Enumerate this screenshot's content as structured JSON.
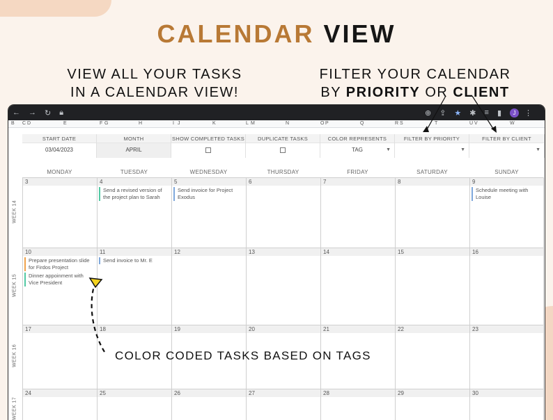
{
  "hero": {
    "title_accent": "CALENDAR",
    "title_dark": "VIEW"
  },
  "captions": {
    "left_line1": "VIEW ALL YOUR TASKS",
    "left_line2": "IN A CALENDAR VIEW!",
    "right_line1": "FILTER YOUR CALENDAR",
    "right_by": "BY",
    "right_priority": "PRIORITY",
    "right_or": "OR",
    "right_client": "CLIENT"
  },
  "annotation": "COLOR CODED TASKS BASED ON TAGS",
  "browser": {
    "avatar": "J",
    "icons": [
      "back-icon",
      "forward-icon",
      "reload-icon",
      "lock-icon",
      "zoom-icon",
      "share-icon",
      "star-icon",
      "extensions-icon",
      "reading-list-icon",
      "sidebar-icon",
      "menu-icon"
    ]
  },
  "column_letters": [
    "B",
    "C",
    "D",
    "E",
    "F",
    "G",
    "H",
    "I",
    "J",
    "K",
    "L",
    "M",
    "N",
    "O",
    "P",
    "Q",
    "R",
    "S",
    "T",
    "U",
    "V",
    "W"
  ],
  "controls": {
    "start_date": {
      "label": "START DATE",
      "value": "03/04/2023"
    },
    "period": {
      "label": "MONTH",
      "value": "APRIL"
    },
    "show_completed": {
      "label": "SHOW COMPLETED TASKS"
    },
    "duplicate": {
      "label": "DUPLICATE TASKS"
    },
    "color_represents": {
      "label": "COLOR REPRESENTS",
      "value": "TAG"
    },
    "filter_priority": {
      "label": "FILTER BY PRIORITY",
      "value": ""
    },
    "filter_client": {
      "label": "FILTER BY CLIENT",
      "value": ""
    }
  },
  "day_names": [
    "MONDAY",
    "TUESDAY",
    "WEDNESDAY",
    "THURSDAY",
    "FRIDAY",
    "SATURDAY",
    "SUNDAY"
  ],
  "weeks": [
    {
      "label": "WEEK 14",
      "days": [
        {
          "num": "3",
          "tasks": []
        },
        {
          "num": "4",
          "tasks": [
            {
              "text": "Send a revised version of the project plan to Sarah",
              "color": "green"
            }
          ]
        },
        {
          "num": "5",
          "tasks": [
            {
              "text": "Send invoice for Project Exodus",
              "color": "blue"
            }
          ]
        },
        {
          "num": "6",
          "tasks": []
        },
        {
          "num": "7",
          "tasks": []
        },
        {
          "num": "8",
          "tasks": []
        },
        {
          "num": "9",
          "tasks": [
            {
              "text": "Schedule meeting with Louise",
              "color": "blue"
            }
          ]
        }
      ]
    },
    {
      "label": "WEEK 15",
      "days": [
        {
          "num": "10",
          "tasks": [
            {
              "text": "Prepare presentation slide for Firdos Project",
              "color": "orange"
            },
            {
              "text": "Dinner appoinment with Vice President",
              "color": "green"
            }
          ]
        },
        {
          "num": "11",
          "tasks": [
            {
              "text": "Send invoice to Mr. E",
              "color": "blue"
            }
          ]
        },
        {
          "num": "12",
          "tasks": []
        },
        {
          "num": "13",
          "tasks": []
        },
        {
          "num": "14",
          "tasks": []
        },
        {
          "num": "15",
          "tasks": []
        },
        {
          "num": "16",
          "tasks": []
        }
      ]
    },
    {
      "label": "WEEK 16",
      "days": [
        {
          "num": "17",
          "tasks": []
        },
        {
          "num": "18",
          "tasks": []
        },
        {
          "num": "19",
          "tasks": []
        },
        {
          "num": "20",
          "tasks": []
        },
        {
          "num": "21",
          "tasks": []
        },
        {
          "num": "22",
          "tasks": []
        },
        {
          "num": "23",
          "tasks": []
        }
      ]
    },
    {
      "label": "WEEK 17",
      "days": [
        {
          "num": "24",
          "tasks": []
        },
        {
          "num": "25",
          "tasks": []
        },
        {
          "num": "26",
          "tasks": []
        },
        {
          "num": "27",
          "tasks": []
        },
        {
          "num": "28",
          "tasks": []
        },
        {
          "num": "29",
          "tasks": []
        },
        {
          "num": "30",
          "tasks": []
        }
      ]
    }
  ]
}
